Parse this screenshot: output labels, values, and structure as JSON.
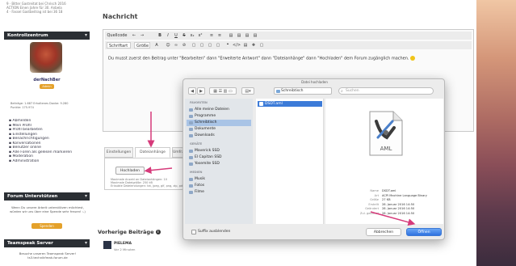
{
  "sidebar": {
    "top_info": [
      "9 · Bitter Gastreitat bei Chrisch 2016",
      "ACTION Einen Jahre für 30. Anbela",
      "4 · Fassel Gastbeitrag ist bei 36 18"
    ],
    "kontrollzentrum": {
      "title": "Kontrollzentrum",
      "username": "derNachBer",
      "rank": "Admin",
      "stats": [
        "Beiträge: 1.687   Erhaltenes Danke: 9.280",
        "Punkte: 175.974"
      ],
      "menu": [
        "Abmelden",
        "Mein Profil",
        "Profil bearbeiten",
        "Einstellungen",
        "Benachrichtigungen",
        "Konversationen",
        "Benutzer online",
        "Alle Foren als gelesen markieren",
        "Moderation",
        "Administration"
      ]
    },
    "forum_support": {
      "title": "Forum Unterstützen",
      "text": "Wenn Du unsere Arbeit unterstützen möchtest, würden wir uns über eine Spende sehr freuen! :-)",
      "button": "Spenden"
    },
    "teamspeak": {
      "title": "Teamspeak Server",
      "text": "Besuche unseren Teamspeak Server! ts3.technikfreak-forum.de"
    }
  },
  "main": {
    "section_title": "Nachricht",
    "toolbar_row1": [
      "Quellcode",
      "←",
      "→",
      "B",
      "I",
      "U",
      "S",
      "x₂",
      "x²",
      "≡",
      "≡",
      "▤",
      "▤",
      "▤",
      "▤"
    ],
    "toolbar_row2": [
      "Schriftart",
      "Größe",
      "A",
      "☺",
      "∞",
      "⊘",
      "▢",
      "▢",
      "▢",
      "▢",
      "❝",
      "</>",
      "▤",
      "❖",
      "▢"
    ],
    "editor_text": "Du musst zuerst den Beitrag unter \"Bearbeiten\" dann \"Erweiterte Antwort\" dann \"Dateianhänge\" dann \"Hochladen\" dem Forum zugänglich machen.",
    "tabs": [
      "Einstellungen",
      "Dateianhänge",
      "Umfrage"
    ],
    "upload_button": "Hochladen",
    "upload_info": [
      "Maximale Anzahl an Dateianhängen: 10",
      "Maximale Dateigröße: 250 kB",
      "Erlaubte Dateiendungen: txt, jpeg, gif, png, zip, pdf"
    ],
    "previous_posts": {
      "title": "Vorherige Beiträge",
      "author": "PIELEMA",
      "time": "Vor 2 Minuten"
    }
  },
  "dialog": {
    "window_title": "Datei hochladen",
    "nav": [
      "◀",
      "▶"
    ],
    "location": "Schreibtisch",
    "search_placeholder": "Suchen",
    "favorites_heading": "FAVORITEN",
    "favorites": [
      "Alle meine Dateien",
      "Programme",
      "Schreibtisch",
      "Dokumente",
      "Downloads"
    ],
    "selected_favorite": 2,
    "devices_heading": "GERÄTE",
    "devices": [
      "Maverick SSD",
      "El Capitan SSD",
      "Yosemite SSD"
    ],
    "media_heading": "MEDIEN",
    "media": [
      "Musik",
      "Fotos",
      "Filme"
    ],
    "selected_file": "DSDT.aml",
    "preview_icon_label": "AML",
    "meta": [
      {
        "key": "Name",
        "value": "DSDT.aml"
      },
      {
        "key": "Art",
        "value": "ACPI Machine Language Binary"
      },
      {
        "key": "Größe",
        "value": "27 KB"
      },
      {
        "key": "Erstellt",
        "value": "28. Januar 2016 14:50"
      },
      {
        "key": "Geändert",
        "value": "28. Januar 2016 14:50"
      },
      {
        "key": "Zul. geöffnet",
        "value": "28. Januar 2016 14:50"
      }
    ],
    "hide_ext_label": "Suffix ausblenden",
    "cancel_label": "Abbrechen",
    "open_label": "Öffnen"
  },
  "colors": {
    "panel_header": "#2b2f34",
    "accent_orange": "#e4a12a",
    "finder_selection": "#3c7bd8",
    "open_button": "#2f72e0",
    "annotation_arrow": "#d63a7a"
  }
}
